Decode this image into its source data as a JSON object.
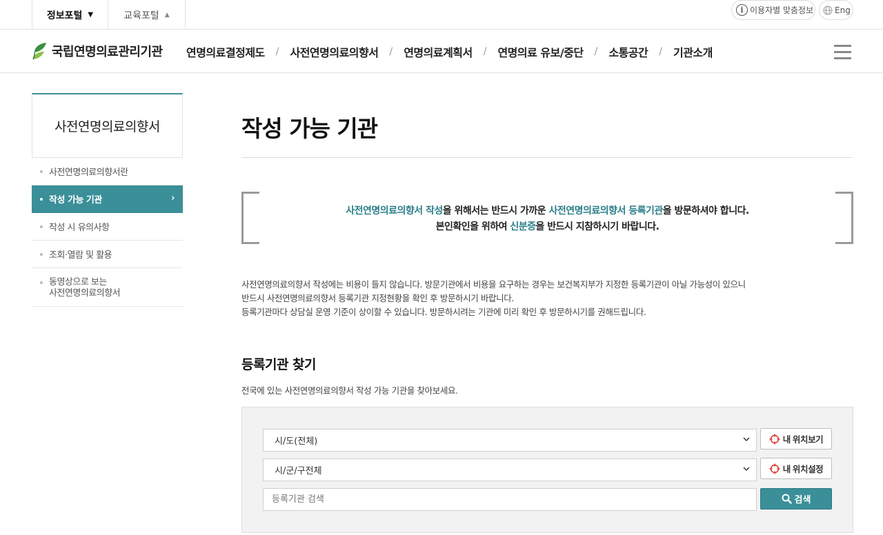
{
  "topbar": {
    "portal_active": "정보포털",
    "portal_active_caret": "▼",
    "portal_inactive": "교육포털",
    "portal_inactive_caret": "▲",
    "custom_info": "이용자별 맞춤정보",
    "eng": "Eng"
  },
  "header": {
    "logo_text": "국립연명의료관리기관",
    "nav": [
      "연명의료결정제도",
      "사전연명의료의향서",
      "연명의료계획서",
      "연명의료 유보/중단",
      "소통공간",
      "기관소개"
    ],
    "nav_separator": "/"
  },
  "snb": {
    "title": "사전연명의료의향서",
    "items": [
      {
        "label": "사전연명의료의향서란"
      },
      {
        "label": "작성 가능 기관",
        "arrow": "›"
      },
      {
        "label": "작성 시 유의사항"
      },
      {
        "label": "조회·열람 및 활용"
      },
      {
        "label_line1": "동영상으로 보는",
        "label_line2": "사전연명의료의향서"
      }
    ]
  },
  "main": {
    "title": "작성 가능 기관",
    "notice": {
      "line1": {
        "hl1": "사전연명의료의향서 작성",
        "t1": "을 위해서는 반드시 가까운 ",
        "hl2": "사전연명의료의향서 등록기관",
        "t2": "을 방문하셔야 합니다."
      },
      "line2": {
        "t1": "본인확인을 위하여 ",
        "hl1": "신분증",
        "t2": "을 반드시 지참하시기 바랍니다."
      }
    },
    "description": [
      "사전연명의료의향서 작성에는 비용이 들지 않습니다. 방문기관에서 비용을 요구하는 경우는 보건복지부가 지정한 등록기관이 아닐 가능성이 있으니",
      "반드시 사전연명의료의향서 등록기관 지정현황을 확인 후 방문하시기 바랍니다.",
      "등록기관마다 상담실 운영 기준이 상이할 수 있습니다. 방문하시려는 기관에 미리 확인 후 방문하시기를 권해드립니다."
    ],
    "section_title": "등록기관 찾기",
    "section_desc": "전국에 있는 사전연명의료의향서 작성 가능 기관을 찾아보세요.",
    "search": {
      "sido_selected": "시/도(전체)",
      "sigungu_selected": "시/군/구전체",
      "keyword_placeholder": "등록기관 검색",
      "my_location_view": "내 위치보기",
      "my_location_set": "내 위치설정",
      "search_button": "검색"
    }
  },
  "colors": {
    "accent": "#3a8f99",
    "highlight_text": "#2b7f89",
    "locate_icon": "#d9342b"
  }
}
